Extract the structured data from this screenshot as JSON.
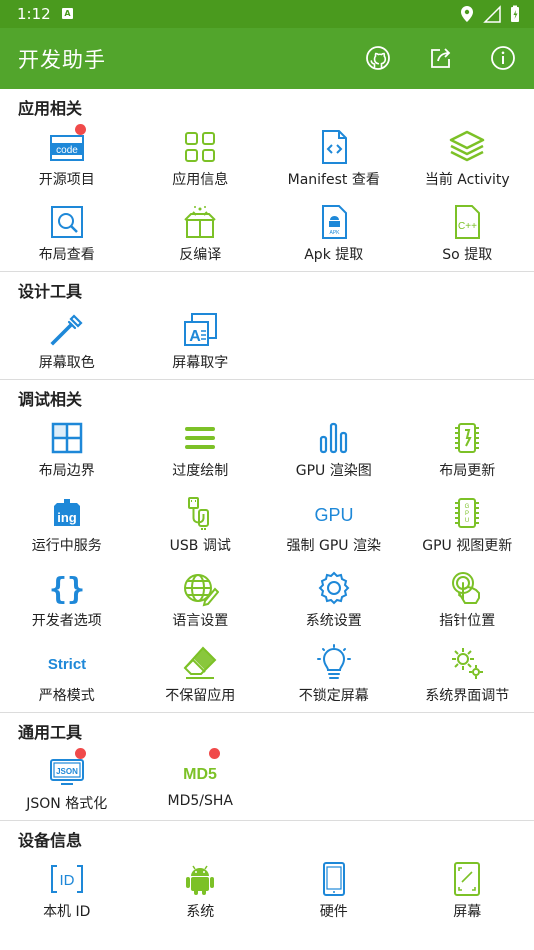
{
  "status": {
    "time": "1:12",
    "notif": "A"
  },
  "appbar": {
    "title": "开发助手"
  },
  "sections": [
    {
      "title": "应用相关",
      "items": [
        {
          "label": "开源项目",
          "icon": "code-file-icon",
          "badge": true,
          "code": "code"
        },
        {
          "label": "应用信息",
          "icon": "grid-apps-icon"
        },
        {
          "label": "Manifest 查看",
          "icon": "code-document-icon"
        },
        {
          "label": "当前 Activity",
          "icon": "layers-icon"
        },
        {
          "label": "布局查看",
          "icon": "magnifier-frame-icon"
        },
        {
          "label": "反编译",
          "icon": "gift-box-icon"
        },
        {
          "label": "Apk 提取",
          "icon": "apk-file-icon",
          "apk": "APK"
        },
        {
          "label": "So 提取",
          "icon": "cpp-file-icon",
          "cpp": "C++"
        }
      ]
    },
    {
      "title": "设计工具",
      "items": [
        {
          "label": "屏幕取色",
          "icon": "eyedropper-icon"
        },
        {
          "label": "屏幕取字",
          "icon": "text-extract-icon"
        }
      ]
    },
    {
      "title": "调试相关",
      "items": [
        {
          "label": "布局边界",
          "icon": "layout-bounds-icon"
        },
        {
          "label": "过度绘制",
          "icon": "overdraw-lines-icon"
        },
        {
          "label": "GPU 渲染图",
          "icon": "bar-graph-icon"
        },
        {
          "label": "布局更新",
          "icon": "chip-icon"
        },
        {
          "label": "运行中服务",
          "icon": "ing-badge-icon",
          "ing": "ing"
        },
        {
          "label": "USB 调试",
          "icon": "usb-cable-icon"
        },
        {
          "label": "强制 GPU 渲染",
          "icon": "gpu-text-icon",
          "gpu": "GPU"
        },
        {
          "label": "GPU 视图更新",
          "icon": "gpu-chip-icon",
          "gpuchip": "G P U"
        },
        {
          "label": "开发者选项",
          "icon": "braces-icon"
        },
        {
          "label": "语言设置",
          "icon": "globe-pen-icon"
        },
        {
          "label": "系统设置",
          "icon": "gear-icon"
        },
        {
          "label": "指针位置",
          "icon": "touch-pointer-icon"
        },
        {
          "label": "严格模式",
          "icon": "strict-text-icon",
          "strict": "Strict"
        },
        {
          "label": "不保留应用",
          "icon": "eraser-icon"
        },
        {
          "label": "不锁定屏幕",
          "icon": "light-bulb-icon"
        },
        {
          "label": "系统界面调节",
          "icon": "gears-icon"
        }
      ]
    },
    {
      "title": "通用工具",
      "items": [
        {
          "label": "JSON 格式化",
          "icon": "json-monitor-icon",
          "badge": true,
          "json": "JSON"
        },
        {
          "label": "MD5/SHA",
          "icon": "md5-text-icon",
          "badge": true,
          "md5": "MD5"
        }
      ]
    },
    {
      "title": "设备信息",
      "items": [
        {
          "label": "本机 ID",
          "icon": "id-bracket-icon",
          "idtext": "ID"
        },
        {
          "label": "系统",
          "icon": "android-icon"
        },
        {
          "label": "硬件",
          "icon": "phone-device-icon"
        },
        {
          "label": "屏幕",
          "icon": "screen-corners-icon"
        }
      ]
    }
  ],
  "colors": {
    "blue": "#1e88d8",
    "green": "#7cc127",
    "appbar": "#52a52c",
    "statusbar": "#4a9a1e",
    "badge": "#f04a4a"
  }
}
